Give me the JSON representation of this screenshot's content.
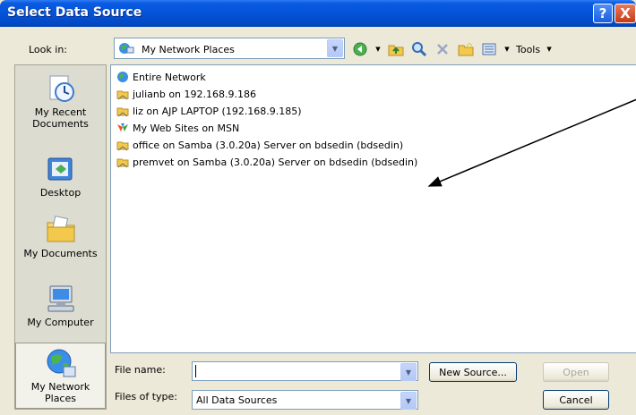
{
  "window": {
    "title": "Select Data Source",
    "help": "?",
    "close": "X"
  },
  "look_in": {
    "label": "Look in:",
    "value": "My Network Places"
  },
  "toolbar": {
    "tools_label": "Tools"
  },
  "places": [
    {
      "label": "My Recent Documents",
      "icon": "recent-documents-icon"
    },
    {
      "label": "Desktop",
      "icon": "desktop-icon"
    },
    {
      "label": "My Documents",
      "icon": "my-documents-icon"
    },
    {
      "label": "My Computer",
      "icon": "my-computer-icon"
    },
    {
      "label": "My Network Places",
      "icon": "network-places-icon"
    }
  ],
  "files": [
    {
      "label": "Entire Network",
      "icon": "globe-icon"
    },
    {
      "label": "julianb on 192.168.9.186",
      "icon": "network-share-icon"
    },
    {
      "label": "liz on AJP LAPTOP (192.168.9.185)",
      "icon": "network-share-icon"
    },
    {
      "label": "My Web Sites on MSN",
      "icon": "msn-icon"
    },
    {
      "label": "office on Samba (3.0.20a) Server on bdsedin (bdsedin)",
      "icon": "network-share-icon"
    },
    {
      "label": "premvet on Samba (3.0.20a) Server on bdsedin (bdsedin)",
      "icon": "network-share-icon"
    }
  ],
  "file_name": {
    "label": "File name:",
    "value": ""
  },
  "files_of_type": {
    "label": "Files of type:",
    "value": "All Data Sources"
  },
  "buttons": {
    "new_source": "New Source...",
    "open": "Open",
    "cancel": "Cancel"
  }
}
